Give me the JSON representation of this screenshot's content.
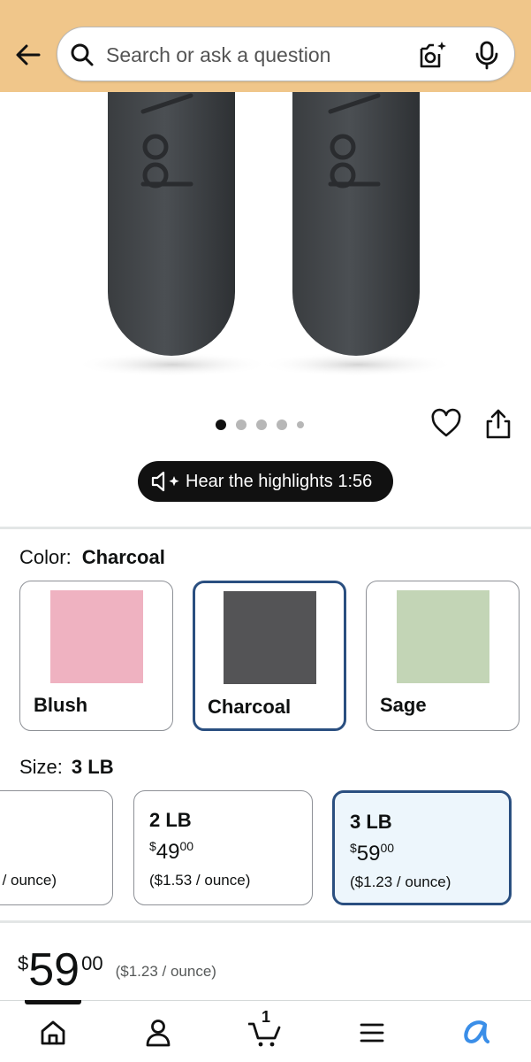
{
  "search": {
    "placeholder": "Search or ask a question"
  },
  "gallery": {
    "image_count": 5,
    "active_index": 0
  },
  "audio": {
    "label": "Hear the highlights 1:56"
  },
  "color": {
    "label": "Color:",
    "selected": "Charcoal",
    "options": [
      {
        "name": "Blush",
        "hex": "#efb2c1"
      },
      {
        "name": "Charcoal",
        "hex": "#545456"
      },
      {
        "name": "Sage",
        "hex": "#c3d5b6"
      }
    ]
  },
  "size": {
    "label": "Size:",
    "selected": "3 LB",
    "options": [
      {
        "unit_price": "/ ounce)"
      },
      {
        "name": "2 LB",
        "currency": "$",
        "whole": "49",
        "fraction": "00",
        "unit_price": "($1.53 / ounce)"
      },
      {
        "name": "3 LB",
        "currency": "$",
        "whole": "59",
        "fraction": "00",
        "unit_price": "($1.23 / ounce)"
      }
    ]
  },
  "price": {
    "currency": "$",
    "whole": "59",
    "fraction": "00",
    "unit_price": "($1.23 / ounce)"
  },
  "cart": {
    "count": "1"
  },
  "colors": {
    "header_bg": "#f0c68a",
    "selected_border": "#2a4f80",
    "selected_bg": "#edf6fc",
    "assistant_blue": "#3a8ee8"
  }
}
